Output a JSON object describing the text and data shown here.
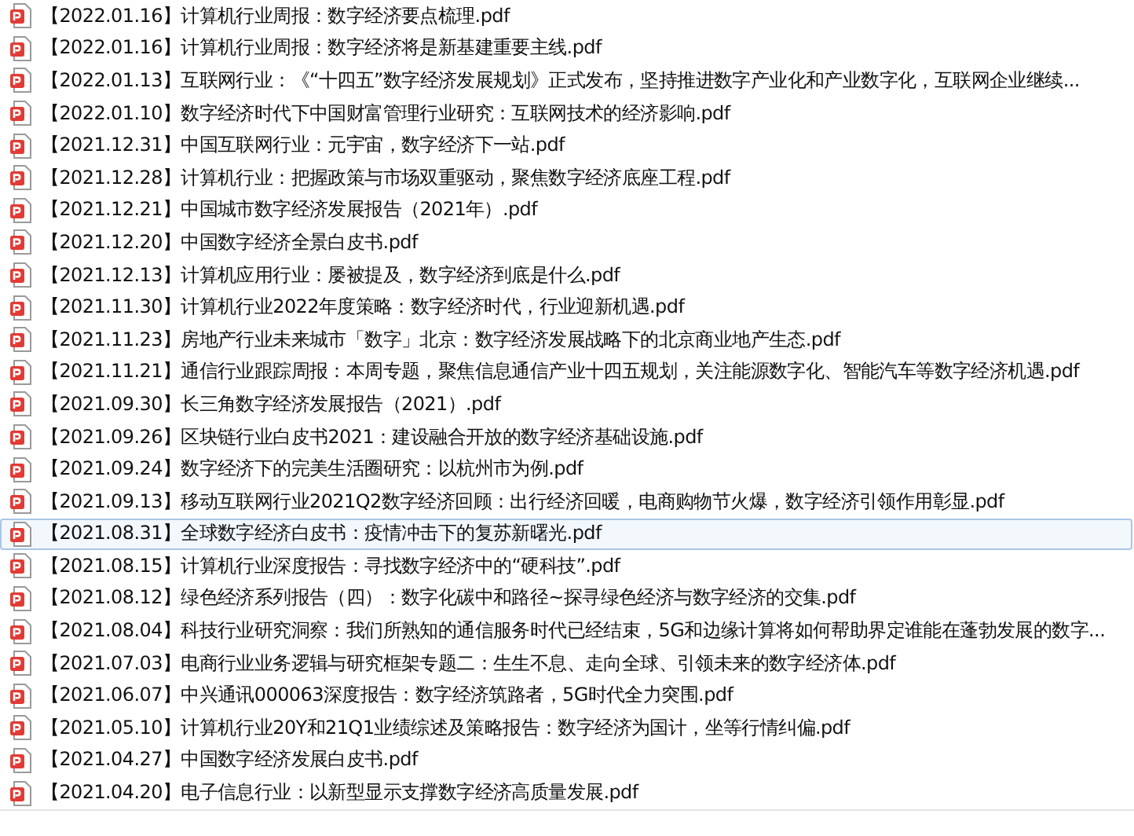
{
  "files": [
    {
      "name": "【2022.01.16】计算机行业周报：数字经济要点梳理.pdf",
      "selected": false
    },
    {
      "name": "【2022.01.16】计算机行业周报：数字经济将是新基建重要主线.pdf",
      "selected": false
    },
    {
      "name": "【2022.01.13】互联网行业：《“十四五”数字经济发展规划》正式发布，坚持推进数字产业化和产业数字化，互联网企业继续...",
      "selected": false
    },
    {
      "name": "【2022.01.10】数字经济时代下中国财富管理行业研究：互联网技术的经济影响.pdf",
      "selected": false
    },
    {
      "name": "【2021.12.31】中国互联网行业：元宇宙，数字经济下一站.pdf",
      "selected": false
    },
    {
      "name": "【2021.12.28】计算机行业：把握政策与市场双重驱动，聚焦数字经济底座工程.pdf",
      "selected": false
    },
    {
      "name": "【2021.12.21】中国城市数字经济发展报告（2021年）.pdf",
      "selected": false
    },
    {
      "name": "【2021.12.20】中国数字经济全景白皮书.pdf",
      "selected": false
    },
    {
      "name": "【2021.12.13】计算机应用行业：屡被提及，数字经济到底是什么.pdf",
      "selected": false
    },
    {
      "name": "【2021.11.30】计算机行业2022年度策略：数字经济时代，行业迎新机遇.pdf",
      "selected": false
    },
    {
      "name": "【2021.11.23】房地产行业未来城市「数字」北京：数字经济发展战略下的北京商业地产生态.pdf",
      "selected": false
    },
    {
      "name": "【2021.11.21】通信行业跟踪周报：本周专题，聚焦信息通信产业十四五规划，关注能源数字化、智能汽车等数字经济机遇.pdf",
      "selected": false
    },
    {
      "name": "【2021.09.30】长三角数字经济发展报告（2021）.pdf",
      "selected": false
    },
    {
      "name": "【2021.09.26】区块链行业白皮书2021：建设融合开放的数字经济基础设施.pdf",
      "selected": false
    },
    {
      "name": "【2021.09.24】数字经济下的完美生活圈研究：以杭州市为例.pdf",
      "selected": false
    },
    {
      "name": "【2021.09.13】移动互联网行业2021Q2数字经济回顾：出行经济回暖，电商购物节火爆，数字经济引领作用彰显.pdf",
      "selected": false
    },
    {
      "name": "【2021.08.31】全球数字经济白皮书：疫情冲击下的复苏新曙光.pdf",
      "selected": true
    },
    {
      "name": "【2021.08.15】计算机行业深度报告：寻找数字经济中的“硬科技”.pdf",
      "selected": false
    },
    {
      "name": "【2021.08.12】绿色经济系列报告（四）：数字化碳中和路径~探寻绿色经济与数字经济的交集.pdf",
      "selected": false
    },
    {
      "name": "【2021.08.04】科技行业研究洞察：我们所熟知的通信服务时代已经结束，5G和边缘计算将如何帮助界定谁能在蓬勃发展的数字...",
      "selected": false
    },
    {
      "name": "【2021.07.03】电商行业业务逻辑与研究框架专题二：生生不息、走向全球、引领未来的数字经济体.pdf",
      "selected": false
    },
    {
      "name": "【2021.06.07】中兴通讯000063深度报告：数字经济筑路者，5G时代全力突围.pdf",
      "selected": false
    },
    {
      "name": "【2021.05.10】计算机行业20Y和21Q1业绩综述及策略报告：数字经济为国计，坐等行情纠偏.pdf",
      "selected": false
    },
    {
      "name": "【2021.04.27】中国数字经济发展白皮书.pdf",
      "selected": false
    },
    {
      "name": "【2021.04.20】电子信息行业：以新型显示支撑数字经济高质量发展.pdf",
      "selected": false
    }
  ]
}
